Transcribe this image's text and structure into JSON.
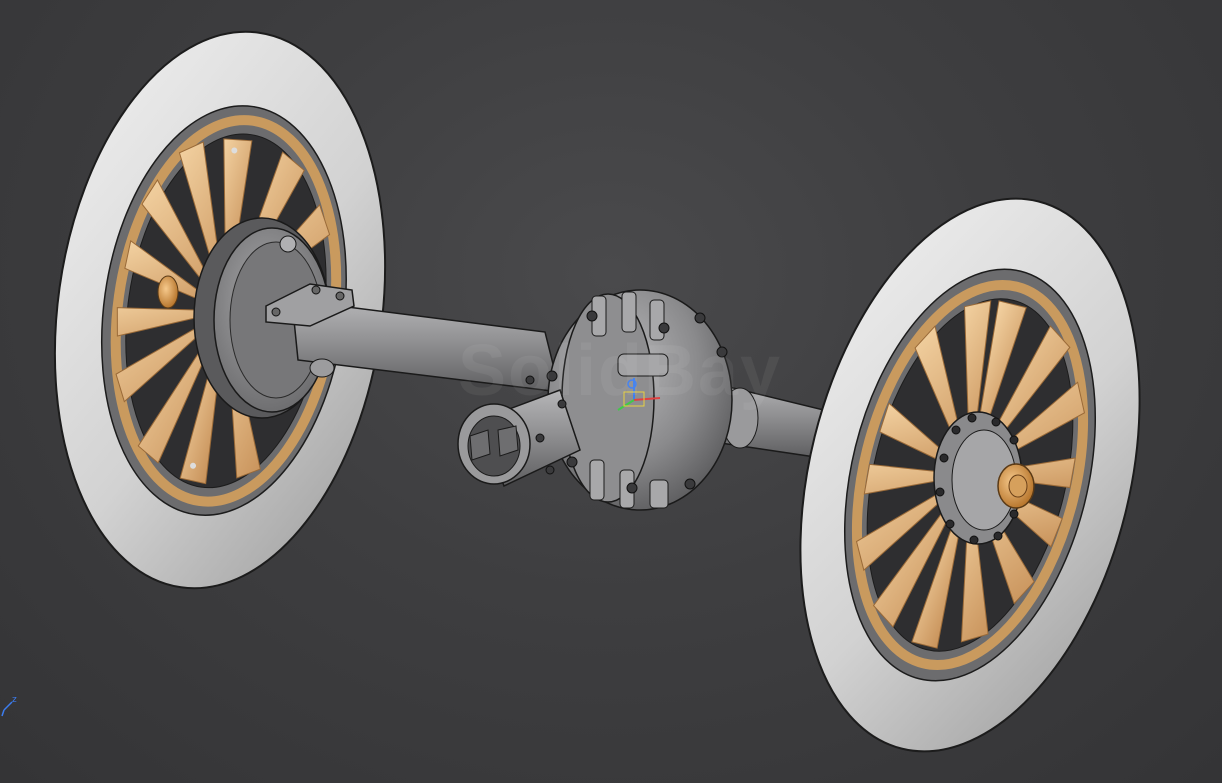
{
  "viewer": {
    "watermark": "SolidBay",
    "background_color": "#3d3d3f"
  },
  "model": {
    "parts": [
      "left-wheel",
      "right-wheel",
      "axle-tube",
      "differential-housing",
      "brake-drum",
      "pinion-flange",
      "hub-nut"
    ],
    "colors": {
      "tire": "#d6d6d6",
      "spoke": "#dfb47c",
      "metal": "#8a8a8c",
      "hub_nut": "#e2a45a"
    }
  },
  "compass": {
    "axis_label": "z",
    "icon": "view-orientation-icon"
  }
}
